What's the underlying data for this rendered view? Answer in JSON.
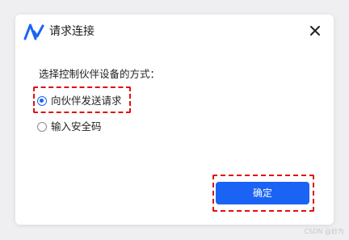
{
  "dialog": {
    "title": "请求连接",
    "prompt": "选择控制伙伴设备的方式：",
    "options": [
      {
        "label": "向伙伴发送请求",
        "selected": true
      },
      {
        "label": "输入安全码",
        "selected": false
      }
    ],
    "confirm_label": "确定"
  },
  "watermark": "CSDN @妙为",
  "colors": {
    "accent": "#1b63f5",
    "highlight": "#e01010"
  },
  "icons": {
    "logo": "app-logo-icon",
    "close": "close-icon"
  }
}
